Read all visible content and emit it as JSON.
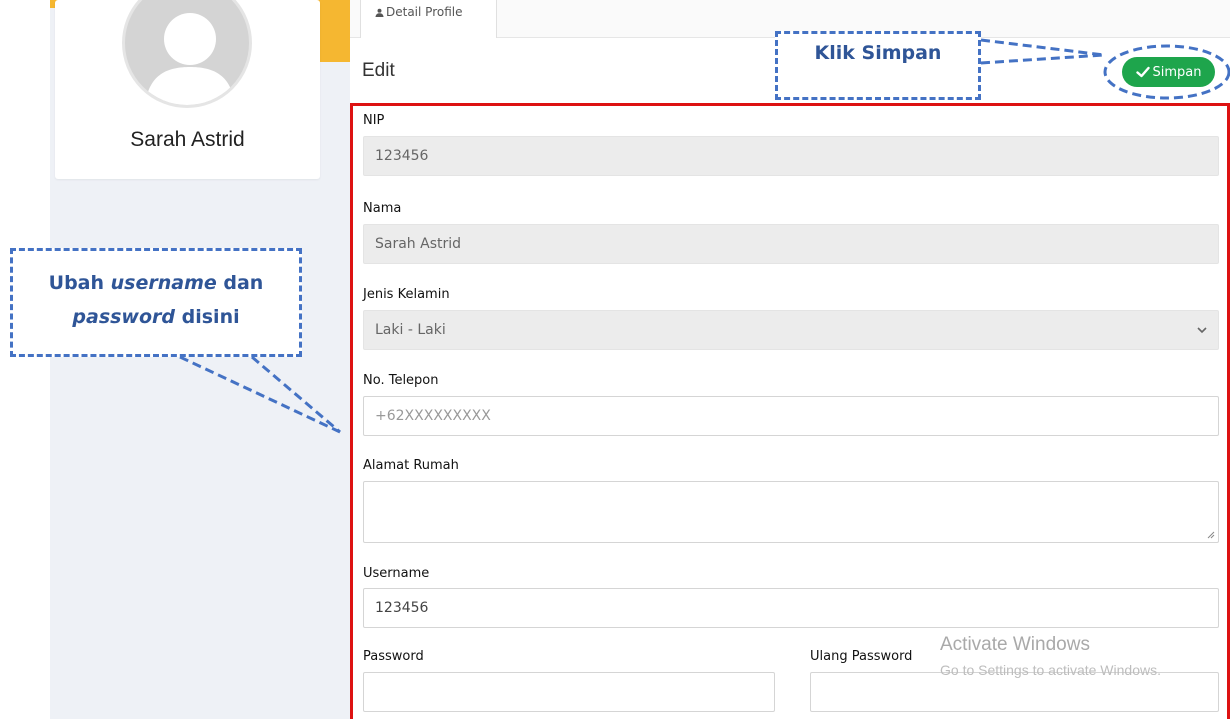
{
  "profile": {
    "name": "Sarah Astrid"
  },
  "tabs": [
    {
      "label": "Detail Profile",
      "icon": "user-icon"
    }
  ],
  "header": {
    "title": "Edit",
    "save_label": "Simpan",
    "save_icon": "check-icon",
    "save_color": "#1ea54c"
  },
  "form": {
    "nip": {
      "label": "NIP",
      "value": "123456"
    },
    "nama": {
      "label": "Nama",
      "value": "Sarah Astrid"
    },
    "jenis_kelamin": {
      "label": "Jenis Kelamin",
      "value": "Laki - Laki"
    },
    "telepon": {
      "label": "No. Telepon",
      "placeholder": "+62XXXXXXXXX"
    },
    "alamat": {
      "label": "Alamat Rumah",
      "value": ""
    },
    "username": {
      "label": "Username",
      "value": "123456"
    },
    "password": {
      "label": "Password",
      "value": ""
    },
    "ulang_password": {
      "label": "Ulang Password",
      "value": ""
    }
  },
  "annotations": {
    "left_bold1": "Ubah ",
    "left_italic1": "username",
    "left_bold2": " dan",
    "left_italic2": "password",
    "left_bold3": " disini",
    "top": "Klik Simpan",
    "color": "#4472c4",
    "highlight_color": "#dd1212"
  },
  "watermark": {
    "line1": "Activate Windows",
    "line2": "Go to Settings to activate Windows."
  }
}
